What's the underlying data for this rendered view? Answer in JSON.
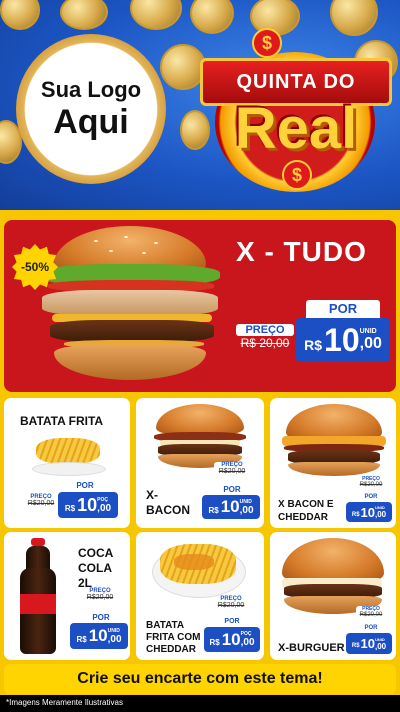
{
  "header": {
    "logo_line1": "Sua Logo",
    "logo_line2": "Aqui",
    "title_top": "QUINTA DO",
    "title_main": "Real",
    "currency_symbol": "$"
  },
  "featured": {
    "discount": "-50%",
    "name": "X - TUDO",
    "old_label": "PREÇO",
    "old_price": "R$ 20,00",
    "new_label": "POR",
    "currency": "R$",
    "price": "10",
    "cents": ",00",
    "unit": "UNID"
  },
  "products": [
    {
      "name": "BATATA FRITA",
      "old_label": "PREÇO",
      "old_price": "R$20,00",
      "new_label": "POR",
      "currency": "R$",
      "price": "10",
      "cents": ",00",
      "unit": "POÇ"
    },
    {
      "name": "X-BACON",
      "old_label": "PREÇO",
      "old_price": "R$20,00",
      "new_label": "POR",
      "currency": "R$",
      "price": "10",
      "cents": ",00",
      "unit": "UNID"
    },
    {
      "name": "X BACON E CHEDDAR",
      "old_label": "PREÇO",
      "old_price": "R$20,00",
      "new_label": "POR",
      "currency": "R$",
      "price": "10",
      "cents": ",00",
      "unit": "UNID"
    },
    {
      "name": "COCA COLA 2L",
      "old_label": "PREÇO",
      "old_price": "R$20,00",
      "new_label": "POR",
      "currency": "R$",
      "price": "10",
      "cents": ",00",
      "unit": "UNID"
    },
    {
      "name": "BATATA FRITA COM CHEDDAR",
      "old_label": "PREÇO",
      "old_price": "R$20,00",
      "new_label": "POR",
      "currency": "R$",
      "price": "10",
      "cents": ",00",
      "unit": "POÇ"
    },
    {
      "name": "X-BURGUER",
      "old_label": "PREÇO",
      "old_price": "R$20,00",
      "new_label": "POR",
      "currency": "R$",
      "price": "10",
      "cents": ",00",
      "unit": "UNID"
    }
  ],
  "cta": "Crie seu encarte com este tema!",
  "disclaimer": "*Imagens Meramente Ilustrativas",
  "colors": {
    "background": "#f6c600",
    "header_blue": "#1c56c4",
    "red": "#c8161c",
    "price_blue": "#1d4fc4"
  }
}
